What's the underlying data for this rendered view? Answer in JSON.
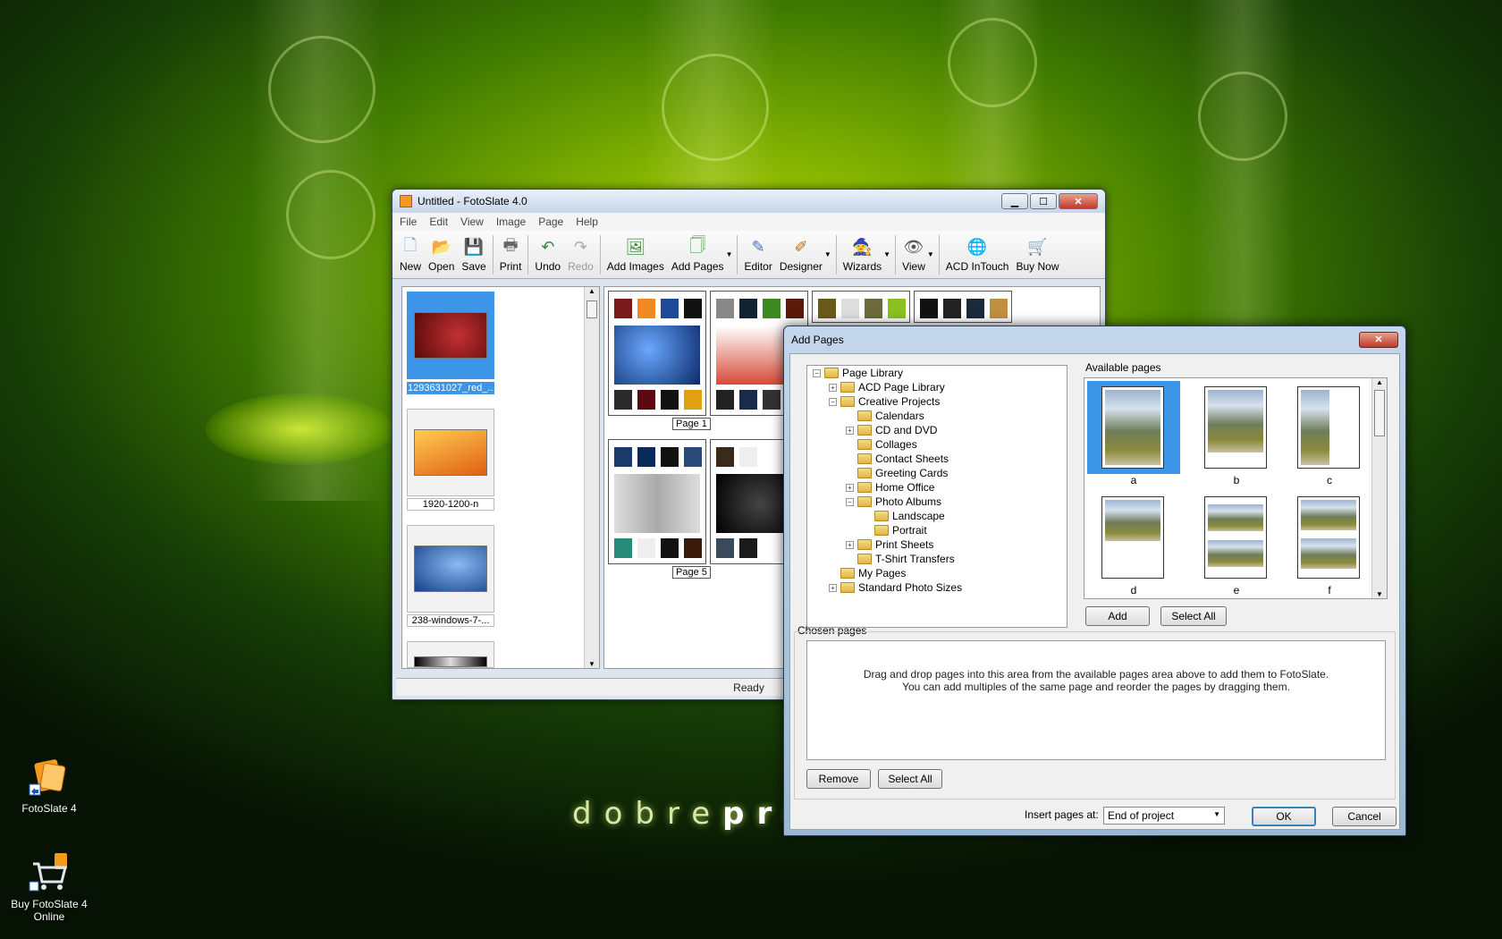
{
  "desktop": {
    "brand_light": "dobre",
    "brand_bold": "pro",
    "icons": [
      {
        "label": "FotoSlate 4"
      },
      {
        "label": "Buy FotoSlate 4 Online"
      }
    ]
  },
  "main_window": {
    "title": "Untitled - FotoSlate 4.0",
    "menu": [
      "File",
      "Edit",
      "View",
      "Image",
      "Page",
      "Help"
    ],
    "toolbar": {
      "new": "New",
      "open": "Open",
      "save": "Save",
      "print": "Print",
      "undo": "Undo",
      "redo": "Redo",
      "add_images": "Add Images",
      "add_pages": "Add Pages",
      "editor": "Editor",
      "designer": "Designer",
      "wizards": "Wizards",
      "view": "View",
      "acd_intouch": "ACD InTouch",
      "buy_now": "Buy Now"
    },
    "images": [
      {
        "label": "1293631027_red_...",
        "selected": true
      },
      {
        "label": "1920-1200-n"
      },
      {
        "label": "238-windows-7-..."
      }
    ],
    "pages": {
      "page1": "Page 1",
      "page5": "Page 5"
    },
    "status": "Ready"
  },
  "dialog": {
    "title": "Add Pages",
    "tree": {
      "root": "Page Library",
      "acd": "ACD Page Library",
      "creative": "Creative Projects",
      "calendars": "Calendars",
      "cd_dvd": "CD and DVD",
      "collages": "Collages",
      "contact": "Contact Sheets",
      "greeting": "Greeting Cards",
      "home_office": "Home Office",
      "photo_albums": "Photo Albums",
      "landscape": "Landscape",
      "portrait": "Portrait",
      "print_sheets": "Print Sheets",
      "tshirt": "T-Shirt Transfers",
      "my_pages": "My Pages",
      "standard": "Standard Photo Sizes"
    },
    "available_label": "Available pages",
    "available": [
      "a",
      "b",
      "c",
      "d",
      "e",
      "f"
    ],
    "add": "Add",
    "select_all": "Select All",
    "chosen_label": "Chosen pages",
    "chosen_hint_1": "Drag and drop pages into this area from the available pages area above to add them to FotoSlate.",
    "chosen_hint_2": "You can add multiples of the same page and reorder the pages by dragging them.",
    "remove": "Remove",
    "select_all_2": "Select All",
    "insert_label": "Insert pages at:",
    "insert_value": "End of project",
    "ok": "OK",
    "cancel": "Cancel"
  }
}
